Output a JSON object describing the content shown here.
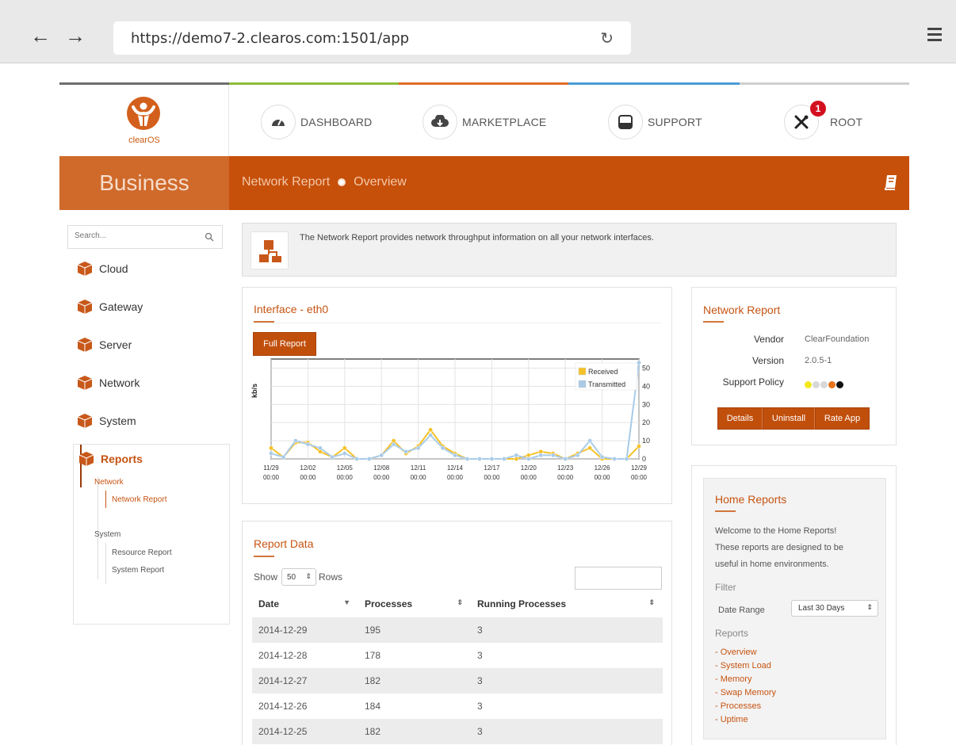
{
  "browser": {
    "url": "https://demo7-2.clearos.com:1501/app",
    "back": "←",
    "forward": "→",
    "reload": "↻"
  },
  "logo": {
    "text": "clearOS"
  },
  "topnav": [
    {
      "label": "DASHBOARD",
      "icon": "dashboard-icon"
    },
    {
      "label": "MARKETPLACE",
      "icon": "cloud-download-icon"
    },
    {
      "label": "SUPPORT",
      "icon": "support-icon"
    },
    {
      "label": "ROOT",
      "icon": "tools-icon",
      "badge": "1"
    }
  ],
  "header": {
    "title": "Business",
    "breadcrumb_section": "Network Report",
    "breadcrumb_page": "Overview",
    "help_icon": "book-icon"
  },
  "sidebar": {
    "search_placeholder": "Search...",
    "items": [
      {
        "label": "Cloud",
        "letter": "C"
      },
      {
        "label": "Gateway",
        "letter": "G"
      },
      {
        "label": "Server",
        "letter": "S"
      },
      {
        "label": "Network",
        "letter": "N"
      },
      {
        "label": "System",
        "letter": "+"
      },
      {
        "label": "Reports",
        "letter": "R"
      }
    ],
    "reports": {
      "group1": "Network",
      "group1_item": "Network Report",
      "group2": "System",
      "group2_items": [
        "Resource Report",
        "System Report"
      ]
    }
  },
  "info": {
    "text": "The Network Report provides network throughput information on all your network interfaces."
  },
  "interface_panel": {
    "title": "Interface - eth0",
    "button": "Full Report"
  },
  "chart_data": {
    "type": "line",
    "ylabel": "kb/s",
    "ylim": [
      0,
      55
    ],
    "yticks": [
      "0",
      "10",
      "20",
      "30",
      "40",
      "50"
    ],
    "xticks": [
      [
        "11/29",
        "00:00"
      ],
      [
        "12/02",
        "00:00"
      ],
      [
        "12/05",
        "00:00"
      ],
      [
        "12/08",
        "00:00"
      ],
      [
        "12/11",
        "00:00"
      ],
      [
        "12/14",
        "00:00"
      ],
      [
        "12/17",
        "00:00"
      ],
      [
        "12/20",
        "00:00"
      ],
      [
        "12/23",
        "00:00"
      ],
      [
        "12/26",
        "00:00"
      ],
      [
        "12/29",
        "00:00"
      ]
    ],
    "x": [
      0,
      1,
      2,
      3,
      4,
      5,
      6,
      7,
      8,
      9,
      10,
      11,
      12,
      13,
      14,
      15,
      16,
      17,
      18,
      19,
      20,
      21,
      22,
      23,
      24,
      25,
      26,
      27,
      28,
      29,
      30
    ],
    "series": [
      {
        "name": "Received",
        "color": "#f5c127",
        "values": [
          6,
          1,
          9,
          9,
          4,
          1,
          6,
          0,
          0,
          2,
          10,
          3,
          7,
          16,
          7,
          3,
          0,
          0,
          0,
          0,
          0,
          2,
          4,
          3,
          0,
          3,
          6,
          0,
          0,
          0,
          7
        ]
      },
      {
        "name": "Transmitted",
        "color": "#a9cbe8",
        "values": [
          3,
          1,
          10,
          8,
          6,
          1,
          3,
          0,
          0,
          2,
          8,
          4,
          6,
          13,
          6,
          2,
          0,
          0,
          0,
          0,
          2,
          0,
          2,
          2,
          0,
          2,
          10,
          1,
          0,
          0,
          53
        ]
      }
    ],
    "legend": "top-right",
    "grid": true
  },
  "report_data": {
    "title": "Report Data",
    "show_label": "Show",
    "rows_value": "50",
    "rows_label": "Rows",
    "columns": [
      "Date",
      "Processes",
      "Running Processes"
    ],
    "rows": [
      [
        "2014-12-29",
        "195",
        "3"
      ],
      [
        "2014-12-28",
        "178",
        "3"
      ],
      [
        "2014-12-27",
        "182",
        "3"
      ],
      [
        "2014-12-26",
        "184",
        "3"
      ],
      [
        "2014-12-25",
        "182",
        "3"
      ]
    ]
  },
  "network_report": {
    "title": "Network Report",
    "vendor_key": "Vendor",
    "vendor_val": "ClearFoundation",
    "version_key": "Version",
    "version_val": "2.0.5-1",
    "support_key": "Support Policy",
    "support_dots": [
      "#f3e81a",
      "#d8d8d8",
      "#d8d8d8",
      "#e8731b",
      "#111111"
    ],
    "buttons": [
      "Details",
      "Uninstall",
      "Rate App"
    ]
  },
  "home_reports": {
    "title": "Home Reports",
    "intro": [
      "Welcome to the Home Reports!",
      "These reports are designed to be",
      "useful in home environments."
    ],
    "filter_label": "Filter",
    "date_range_label": "Date Range",
    "date_range_value": "Last 30 Days",
    "reports_label": "Reports",
    "links": [
      "- Overview",
      "- System Load",
      "- Memory",
      "- Swap Memory",
      "- Processes",
      "- Uptime"
    ]
  }
}
